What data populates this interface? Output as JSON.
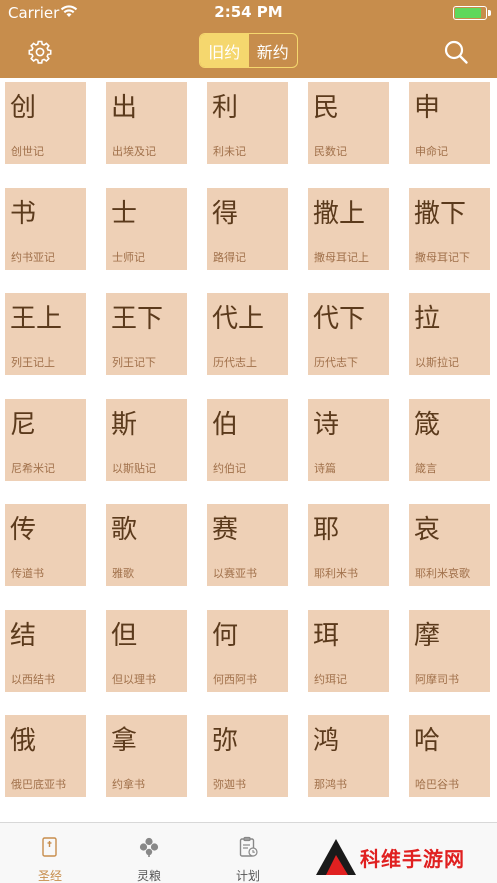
{
  "status_bar": {
    "carrier": "Carrier",
    "time": "2:54 PM",
    "battery_level": 0.9,
    "battery_color": "#5fd85b"
  },
  "header": {
    "bg_color": "#c78d4c",
    "settings_icon": "gear-icon",
    "search_icon": "search-icon",
    "segments": [
      {
        "label": "旧约",
        "selected": true
      },
      {
        "label": "新约",
        "selected": false
      }
    ],
    "accent": "#f5d76e"
  },
  "books": [
    {
      "abbr": "创",
      "name": "创世记"
    },
    {
      "abbr": "出",
      "name": "出埃及记"
    },
    {
      "abbr": "利",
      "name": "利未记"
    },
    {
      "abbr": "民",
      "name": "民数记"
    },
    {
      "abbr": "申",
      "name": "申命记"
    },
    {
      "abbr": "书",
      "name": "约书亚记"
    },
    {
      "abbr": "士",
      "name": "士师记"
    },
    {
      "abbr": "得",
      "name": "路得记"
    },
    {
      "abbr": "撒上",
      "name": "撒母耳记上"
    },
    {
      "abbr": "撒下",
      "name": "撒母耳记下"
    },
    {
      "abbr": "王上",
      "name": "列王记上"
    },
    {
      "abbr": "王下",
      "name": "列王记下"
    },
    {
      "abbr": "代上",
      "name": "历代志上"
    },
    {
      "abbr": "代下",
      "name": "历代志下"
    },
    {
      "abbr": "拉",
      "name": "以斯拉记"
    },
    {
      "abbr": "尼",
      "name": "尼希米记"
    },
    {
      "abbr": "斯",
      "name": "以斯贴记"
    },
    {
      "abbr": "伯",
      "name": "约伯记"
    },
    {
      "abbr": "诗",
      "name": "诗篇"
    },
    {
      "abbr": "箴",
      "name": "箴言"
    },
    {
      "abbr": "传",
      "name": "传道书"
    },
    {
      "abbr": "歌",
      "name": "雅歌"
    },
    {
      "abbr": "赛",
      "name": "以赛亚书"
    },
    {
      "abbr": "耶",
      "name": "耶利米书"
    },
    {
      "abbr": "哀",
      "name": "耶利米哀歌"
    },
    {
      "abbr": "结",
      "name": "以西结书"
    },
    {
      "abbr": "但",
      "name": "但以理书"
    },
    {
      "abbr": "何",
      "name": "何西阿书"
    },
    {
      "abbr": "珥",
      "name": "约珥记"
    },
    {
      "abbr": "摩",
      "name": "阿摩司书"
    },
    {
      "abbr": "俄",
      "name": "俄巴底亚书"
    },
    {
      "abbr": "拿",
      "name": "约拿书"
    },
    {
      "abbr": "弥",
      "name": "弥迦书"
    },
    {
      "abbr": "鸿",
      "name": "那鸿书"
    },
    {
      "abbr": "哈",
      "name": "哈巴谷书"
    }
  ],
  "tabbar": {
    "tabs": [
      {
        "label": "圣经",
        "icon": "book-icon",
        "selected": true
      },
      {
        "label": "灵粮",
        "icon": "clover-icon",
        "selected": false
      },
      {
        "label": "计划",
        "icon": "clipboard-icon",
        "selected": false
      }
    ]
  },
  "watermark": {
    "text": "科维手游网"
  }
}
